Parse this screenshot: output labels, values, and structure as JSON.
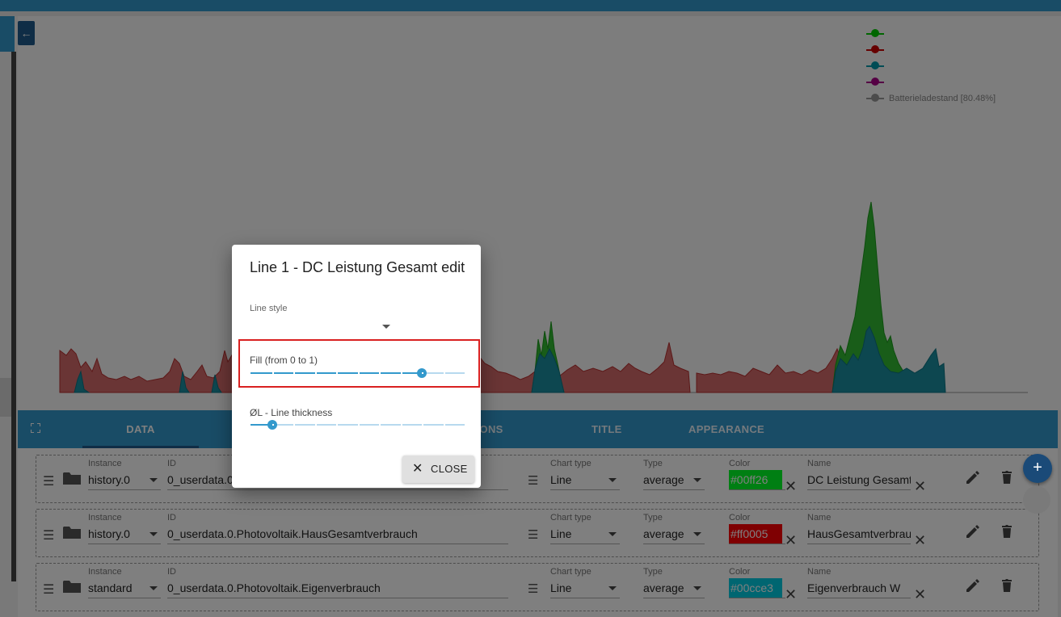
{
  "legend": [
    {
      "text": "",
      "color": "#00cc00"
    },
    {
      "text": "",
      "color": "#cc0000"
    },
    {
      "text": "",
      "color": "#0099aa"
    },
    {
      "text": "",
      "color": "#aa0088"
    },
    {
      "text": "Batterieladestand [80.48%]",
      "color": "#999999"
    }
  ],
  "tabs": {
    "data": "DATA",
    "options": "OPTIONS",
    "title": "TITLE",
    "appearance": "APPEARANCE"
  },
  "field_labels": {
    "instance": "Instance",
    "id": "ID",
    "chart_type": "Chart type",
    "type": "Type",
    "color": "Color",
    "name": "Name"
  },
  "rows": [
    {
      "instance": "history.0",
      "id": "0_userdata.0.Photovoltaik.DC_Leistung_Gesamt",
      "chart_type": "Line",
      "type": "average",
      "color": "#00ff26",
      "name": "DC Leistung Gesamt"
    },
    {
      "instance": "history.0",
      "id": "0_userdata.0.Photovoltaik.HausGesamtverbrauch",
      "chart_type": "Line",
      "type": "average",
      "color": "#ff0005",
      "name": "HausGesamtverbrauch"
    },
    {
      "instance": "standard",
      "id": "0_userdata.0.Photovoltaik.Eigenverbrauch",
      "chart_type": "Line",
      "type": "average",
      "color": "#00cce3",
      "name": "Eigenverbrauch W"
    }
  ],
  "dialog": {
    "title": "Line 1 - DC Leistung Gesamt edit",
    "line_style_label": "Line style",
    "line_style_value": "",
    "fill_label": "Fill (from 0 to 1)",
    "fill_value": 0.8,
    "thickness_label": "ØL - Line thickness",
    "thickness_value": 1,
    "close_label": "CLOSE"
  },
  "fab": {
    "label": "+"
  }
}
